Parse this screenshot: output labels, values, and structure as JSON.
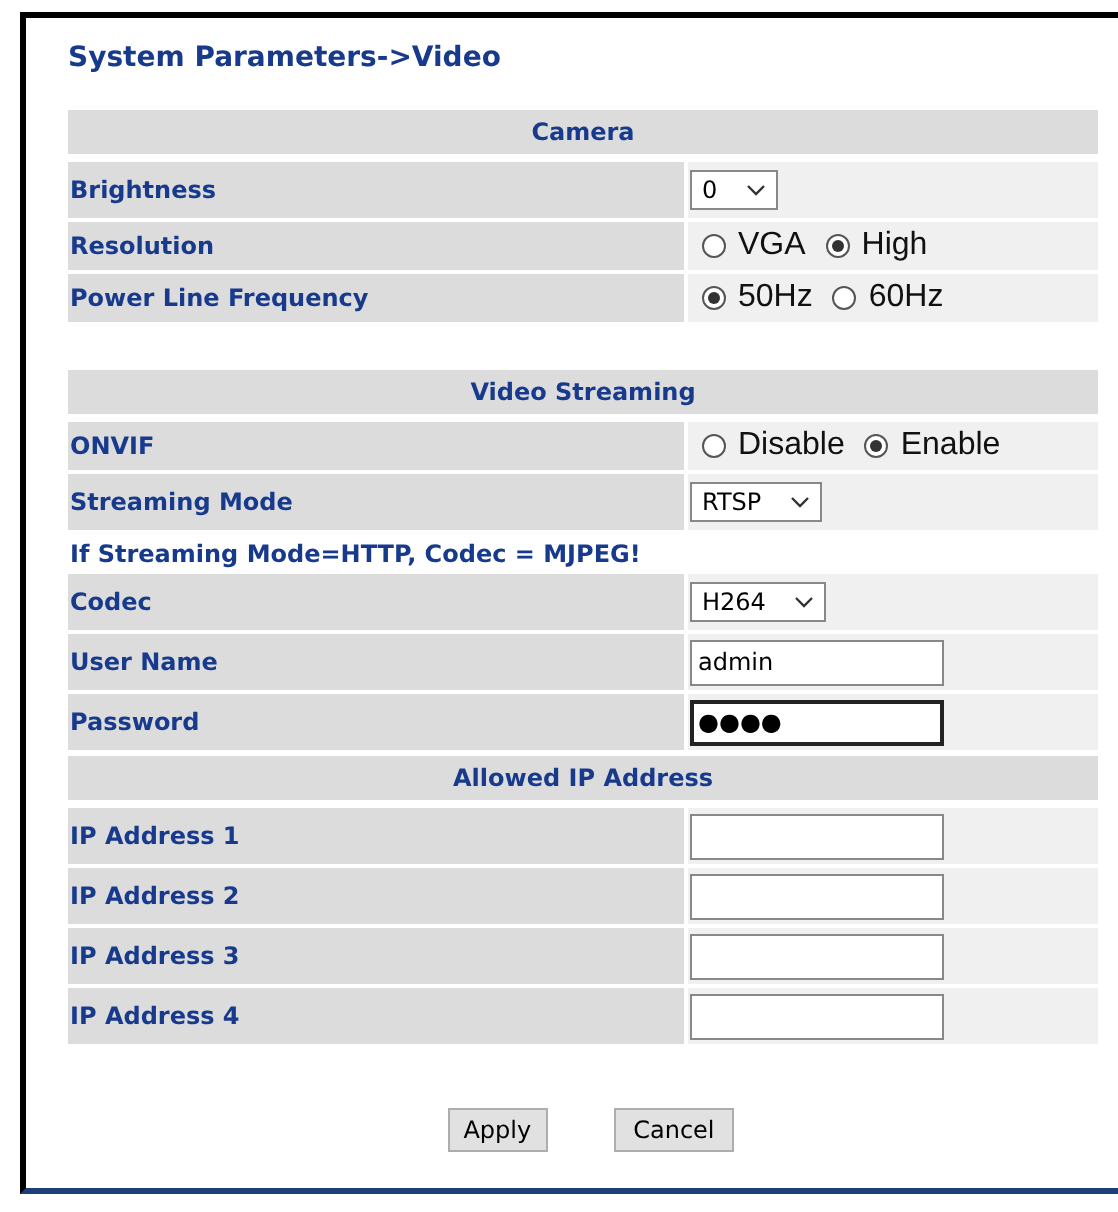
{
  "title": "System Parameters->Video",
  "sections": [
    {
      "title": "Camera",
      "rows": [
        {
          "kind": "select",
          "label": "Brightness",
          "value": "0"
        },
        {
          "kind": "radio",
          "label": "Resolution",
          "options": [
            {
              "label": "VGA",
              "selected": false
            },
            {
              "label": "High",
              "selected": true
            }
          ]
        },
        {
          "kind": "radio",
          "label": "Power Line Frequency",
          "options": [
            {
              "label": "50Hz",
              "selected": true
            },
            {
              "label": "60Hz",
              "selected": false
            }
          ]
        }
      ]
    },
    {
      "title": "Video Streaming",
      "rows": [
        {
          "kind": "radio",
          "label": "ONVIF",
          "options": [
            {
              "label": "Disable",
              "selected": false
            },
            {
              "label": "Enable",
              "selected": true
            }
          ]
        },
        {
          "kind": "select",
          "label": "Streaming Mode",
          "value": "RTSP"
        },
        {
          "kind": "note",
          "label": "If Streaming Mode=HTTP, Codec = MJPEG!"
        },
        {
          "kind": "select",
          "label": "Codec",
          "value": "H264"
        },
        {
          "kind": "text",
          "label": "User Name",
          "value": "admin"
        },
        {
          "kind": "password",
          "label": "Password",
          "value": "●●●●"
        }
      ]
    },
    {
      "title": "Allowed IP Address",
      "rows": [
        {
          "kind": "text",
          "label": "IP Address 1"
        },
        {
          "kind": "text",
          "label": "IP Address 2"
        },
        {
          "kind": "text",
          "label": "IP Address 3"
        },
        {
          "kind": "text",
          "label": "IP Address 4"
        }
      ]
    }
  ],
  "buttons": [
    "Apply",
    "Cancel"
  ]
}
